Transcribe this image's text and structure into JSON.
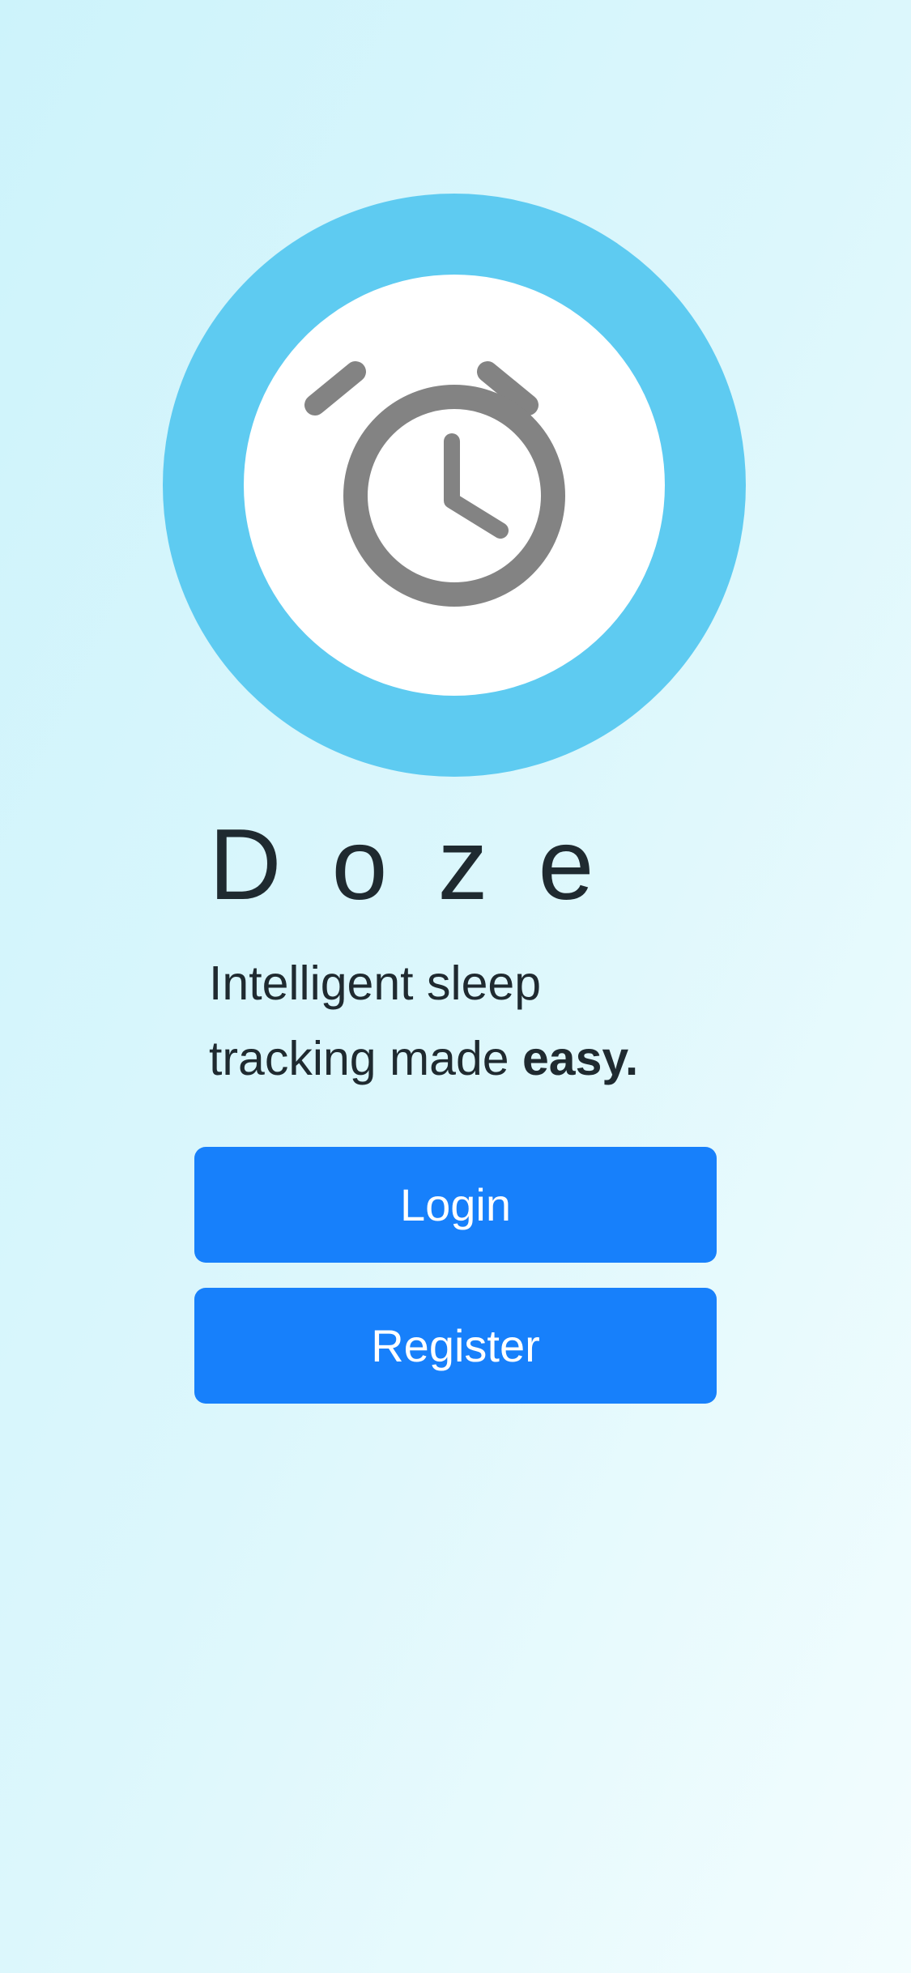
{
  "app": {
    "name": "Doze",
    "logo_icon": "alarm-clock-icon",
    "tagline_text": "Intelligent sleep tracking made ",
    "tagline_emphasis": "easy."
  },
  "actions": {
    "login_label": "Login",
    "register_label": "Register"
  },
  "colors": {
    "logo_ring": "#5ecbf1",
    "logo_center": "#ffffff",
    "icon": "#838383",
    "button": "#1780fb",
    "button_text": "#ffffff",
    "text": "#1f2a30",
    "background_start": "#cdf3fb",
    "background_end": "#f3fdfe"
  }
}
